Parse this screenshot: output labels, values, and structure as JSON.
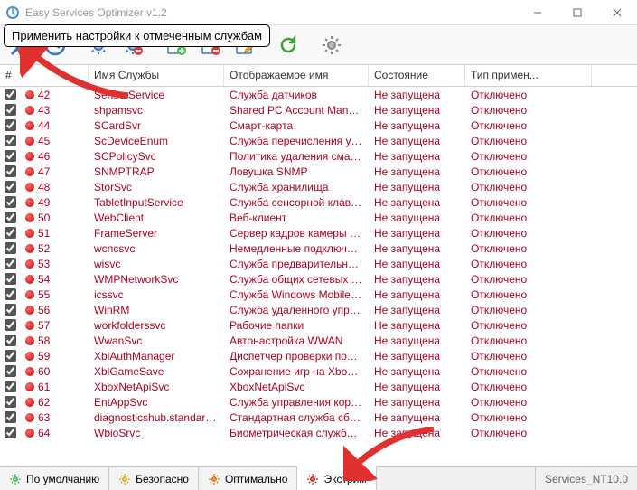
{
  "window": {
    "title": "Easy Services Optimizer v1.2",
    "tooltip": "Применить настройки к отмеченным службам"
  },
  "headers": {
    "pound": "#",
    "name": "Имя Службы",
    "display": "Отображаемое имя",
    "state": "Состояние",
    "type": "Тип примен..."
  },
  "tabs": {
    "default": "По умолчанию",
    "safe": "Безопасно",
    "optimal": "Оптимально",
    "extreme": "Экстрим"
  },
  "status": "Services_NT10.0",
  "rows": [
    {
      "n": "42",
      "chk": true,
      "name": "SensorService",
      "disp": "Служба датчиков",
      "state": "Не запущена",
      "type": "Отключено"
    },
    {
      "n": "43",
      "chk": true,
      "name": "shpamsvc",
      "disp": "Shared PC Account Manager",
      "state": "Не запущена",
      "type": "Отключено"
    },
    {
      "n": "44",
      "chk": true,
      "name": "SCardSvr",
      "disp": "Смарт-карта",
      "state": "Не запущена",
      "type": "Отключено"
    },
    {
      "n": "45",
      "chk": true,
      "name": "ScDeviceEnum",
      "disp": "Служба перечисления устрой...",
      "state": "Не запущена",
      "type": "Отключено"
    },
    {
      "n": "46",
      "chk": true,
      "name": "SCPolicySvc",
      "disp": "Политика удаления смарт-карт",
      "state": "Не запущена",
      "type": "Отключено"
    },
    {
      "n": "47",
      "chk": true,
      "name": "SNMPTRAP",
      "disp": "Ловушка SNMP",
      "state": "Не запущена",
      "type": "Отключено"
    },
    {
      "n": "48",
      "chk": true,
      "name": "StorSvc",
      "disp": "Служба хранилища",
      "state": "Не запущена",
      "type": "Отключено"
    },
    {
      "n": "49",
      "chk": true,
      "name": "TabletInputService",
      "disp": "Служба сенсорной клавиатур...",
      "state": "Не запущена",
      "type": "Отключено"
    },
    {
      "n": "50",
      "chk": true,
      "name": "WebClient",
      "disp": "Веб-клиент",
      "state": "Не запущена",
      "type": "Отключено"
    },
    {
      "n": "51",
      "chk": true,
      "name": "FrameServer",
      "disp": "Сервер кадров камеры Windo...",
      "state": "Не запущена",
      "type": "Отключено"
    },
    {
      "n": "52",
      "chk": true,
      "name": "wcncsvc",
      "disp": "Немедленные подключения W...",
      "state": "Не запущена",
      "type": "Отключено"
    },
    {
      "n": "53",
      "chk": true,
      "name": "wisvc",
      "disp": "Служба предварительной оц...",
      "state": "Не запущена",
      "type": "Отключено"
    },
    {
      "n": "54",
      "chk": true,
      "name": "WMPNetworkSvc",
      "disp": "Служба общих сетевых ресу...",
      "state": "Не запущена",
      "type": "Отключено"
    },
    {
      "n": "55",
      "chk": true,
      "name": "icssvc",
      "disp": "Служба Windows Mobile Hotspot",
      "state": "Не запущена",
      "type": "Отключено"
    },
    {
      "n": "56",
      "chk": true,
      "name": "WinRM",
      "disp": "Служба удаленного управле...",
      "state": "Не запущена",
      "type": "Отключено"
    },
    {
      "n": "57",
      "chk": true,
      "name": "workfolderssvc",
      "disp": "Рабочие папки",
      "state": "Не запущена",
      "type": "Отключено"
    },
    {
      "n": "58",
      "chk": true,
      "name": "WwanSvc",
      "disp": "Автонастройка WWAN",
      "state": "Не запущена",
      "type": "Отключено"
    },
    {
      "n": "59",
      "chk": true,
      "name": "XblAuthManager",
      "disp": "Диспетчер проверки подлин...",
      "state": "Не запущена",
      "type": "Отключено"
    },
    {
      "n": "60",
      "chk": true,
      "name": "XblGameSave",
      "disp": "Сохранение игр на Xbox Live",
      "state": "Не запущена",
      "type": "Отключено"
    },
    {
      "n": "61",
      "chk": true,
      "name": "XboxNetApiSvc",
      "disp": "XboxNetApiSvc",
      "state": "Не запущена",
      "type": "Отключено"
    },
    {
      "n": "62",
      "chk": true,
      "name": "EntAppSvc",
      "disp": "Служба управления корпора...",
      "state": "Не запущена",
      "type": "Отключено"
    },
    {
      "n": "63",
      "chk": true,
      "name": "diagnosticshub.standardc...",
      "disp": "Стандартная служба сборщи...",
      "state": "Не запущена",
      "type": "Отключено"
    },
    {
      "n": "64",
      "chk": true,
      "name": "WbioSrvc",
      "disp": "Биометрическая служба Win...",
      "state": "Не запущена",
      "type": "Отключено"
    }
  ]
}
